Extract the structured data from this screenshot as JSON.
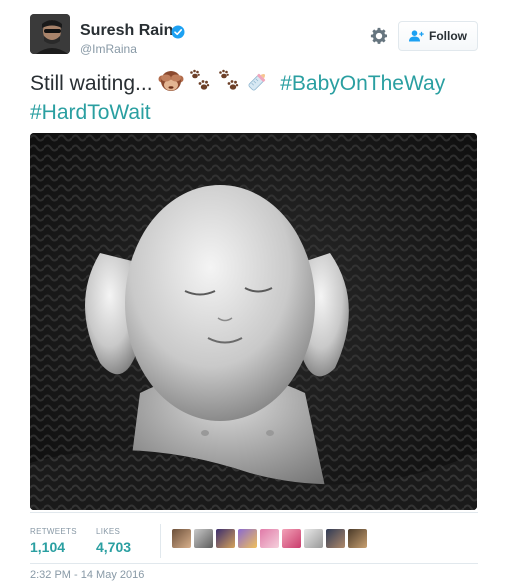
{
  "author": {
    "name": "Suresh Raina",
    "handle": "@ImRaina",
    "verified": true,
    "avatar_icon": "profile-photo"
  },
  "actions": {
    "settings_icon": "gear-icon",
    "follow_label": "Follow",
    "follow_icon": "add-user-icon"
  },
  "tweet": {
    "text_prefix": "Still waiting...",
    "emojis": [
      "see-no-evil-monkey",
      "paw-prints",
      "paw-prints",
      "baby-bottle"
    ],
    "hashtags": [
      "#BabyOnTheWay",
      "#HardToWait"
    ],
    "media": "photo of sleeping newborn baby, black and white"
  },
  "stats": {
    "retweets_label": "RETWEETS",
    "retweets_value": "1,104",
    "likes_label": "LIKES",
    "likes_value": "4,703",
    "liker_count_shown": 9
  },
  "timestamp": "2:32 PM - 14 May 2016",
  "colors": {
    "link": "#2a9fa1",
    "text": "#292f33",
    "muted": "#8899a6",
    "verified": "#1da1f2"
  }
}
